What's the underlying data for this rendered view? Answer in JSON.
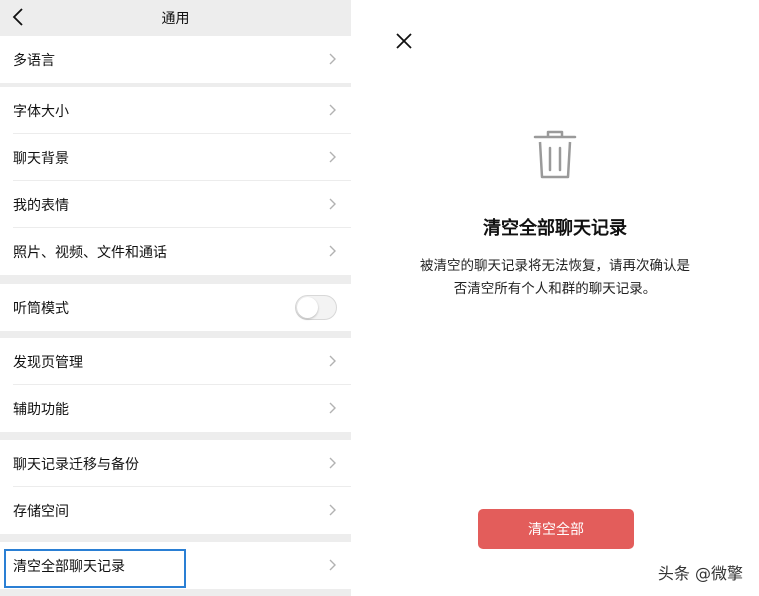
{
  "header": {
    "title": "通用",
    "back_icon": "chevron-left-icon"
  },
  "settings": {
    "language": "多语言",
    "font_size": "字体大小",
    "chat_background": "聊天背景",
    "my_stickers": "我的表情",
    "media_files_calls": "照片、视频、文件和通话",
    "earpiece_mode": "听筒模式",
    "discover_management": "发现页管理",
    "accessibility": "辅助功能",
    "chat_backup": "聊天记录迁移与备份",
    "storage": "存储空间",
    "clear_all_chats": "清空全部聊天记录"
  },
  "dialog": {
    "close_icon": "close-icon",
    "icon": "trash-icon",
    "title": "清空全部聊天记录",
    "description_line1": "被清空的聊天记录将无法恢复，请再次确认是",
    "description_line2": "否清空所有个人和群的聊天记录。",
    "confirm_label": "清空全部"
  },
  "watermark": "头条 @微擎",
  "colors": {
    "danger": "#e35d5b",
    "highlight": "#2a7fd4",
    "page_bg": "#ededed"
  }
}
